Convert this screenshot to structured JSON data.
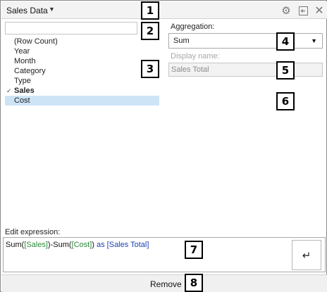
{
  "window": {
    "title": "Sales Data",
    "caret_glyph": "▼",
    "icons": {
      "settings": "gear-icon",
      "dock": "dock-panel-icon",
      "close": "close-icon"
    },
    "close_glyph": "✕",
    "gear_glyph": "⚙"
  },
  "search": {
    "value": "",
    "placeholder": ""
  },
  "columns": [
    {
      "label": "(Row Count)",
      "checked": false,
      "selected": false
    },
    {
      "label": "Year",
      "checked": false,
      "selected": false
    },
    {
      "label": "Month",
      "checked": false,
      "selected": false
    },
    {
      "label": "Category",
      "checked": false,
      "selected": false
    },
    {
      "label": "Type",
      "checked": false,
      "selected": false
    },
    {
      "label": "Sales",
      "checked": true,
      "selected": false
    },
    {
      "label": "Cost",
      "checked": false,
      "selected": true
    }
  ],
  "check_glyph": "✓",
  "aggregation": {
    "label": "Aggregation:",
    "value": "Sum",
    "caret_glyph": "▼"
  },
  "display_name": {
    "label": "Display name:",
    "value": "Sales Total"
  },
  "expression": {
    "label": "Edit expression:",
    "parts": {
      "fn1": "Sum(",
      "col1": "[Sales]",
      "mid": ")-Sum(",
      "col2": "[Cost]",
      "close": ")",
      "as": " as ",
      "alias": "[Sales Total]"
    },
    "enter_glyph": "↵"
  },
  "footer": {
    "remove_label": "Remove"
  },
  "callouts": [
    "1",
    "2",
    "3",
    "4",
    "5",
    "6",
    "7",
    "8"
  ],
  "colors": {
    "selected_row": "#cde4f7",
    "column_ref": "#2c8a3b",
    "keyword": "#1a3fb5"
  }
}
